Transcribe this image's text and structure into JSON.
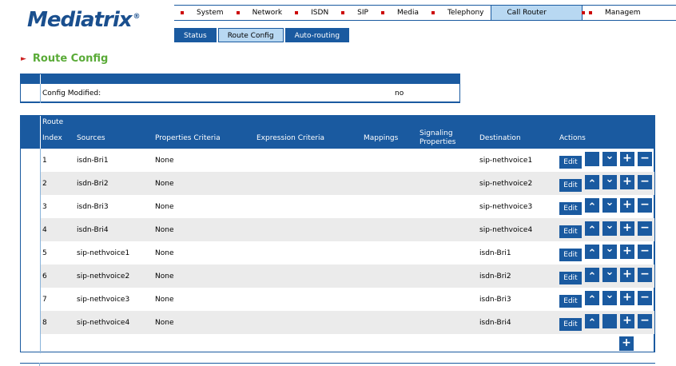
{
  "logo": {
    "text": "Mediatrix",
    "mark": "®"
  },
  "topnav": [
    {
      "label": "System",
      "active": false
    },
    {
      "label": "Network",
      "active": false
    },
    {
      "label": "ISDN",
      "active": false
    },
    {
      "label": "SIP",
      "active": false
    },
    {
      "label": "Media",
      "active": false
    },
    {
      "label": "Telephony",
      "active": false
    },
    {
      "label": "Call Router",
      "active": true
    },
    {
      "label": "Managem",
      "active": false
    }
  ],
  "subnav": [
    {
      "label": "Status",
      "active": false
    },
    {
      "label": "Route Config",
      "active": true
    },
    {
      "label": "Auto-routing",
      "active": false
    }
  ],
  "page": {
    "title": "Route Config"
  },
  "config": {
    "label": "Config Modified:",
    "value": "no"
  },
  "table": {
    "headers": {
      "index_top": "Route",
      "index": "Index",
      "sources": "Sources",
      "properties": "Properties Criteria",
      "expression": "Expression Criteria",
      "mappings": "Mappings",
      "signaling_1": "Signaling",
      "signaling_2": "Properties",
      "destination": "Destination",
      "actions": "Actions"
    },
    "edit_label": "Edit",
    "rows": [
      {
        "index": "1",
        "source": "isdn-Bri1",
        "properties": "None",
        "destination": "sip-nethvoice1",
        "up": false,
        "down": true
      },
      {
        "index": "2",
        "source": "isdn-Bri2",
        "properties": "None",
        "destination": "sip-nethvoice2",
        "up": true,
        "down": true
      },
      {
        "index": "3",
        "source": "isdn-Bri3",
        "properties": "None",
        "destination": "sip-nethvoice3",
        "up": true,
        "down": true
      },
      {
        "index": "4",
        "source": "isdn-Bri4",
        "properties": "None",
        "destination": "sip-nethvoice4",
        "up": true,
        "down": true
      },
      {
        "index": "5",
        "source": "sip-nethvoice1",
        "properties": "None",
        "destination": "isdn-Bri1",
        "up": true,
        "down": true
      },
      {
        "index": "6",
        "source": "sip-nethvoice2",
        "properties": "None",
        "destination": "isdn-Bri2",
        "up": true,
        "down": true
      },
      {
        "index": "7",
        "source": "sip-nethvoice3",
        "properties": "None",
        "destination": "isdn-Bri3",
        "up": true,
        "down": true
      },
      {
        "index": "8",
        "source": "sip-nethvoice4",
        "properties": "None",
        "destination": "isdn-Bri4",
        "up": true,
        "down": false
      }
    ]
  },
  "icons": {
    "up": "chevron-up-icon",
    "down": "chevron-down-icon",
    "add": "plus-icon",
    "remove": "minus-icon"
  },
  "colors": {
    "primary": "#1a5aa0",
    "active_tab": "#b8d8f2",
    "title": "#5aab38",
    "bullet": "#cc0000"
  }
}
